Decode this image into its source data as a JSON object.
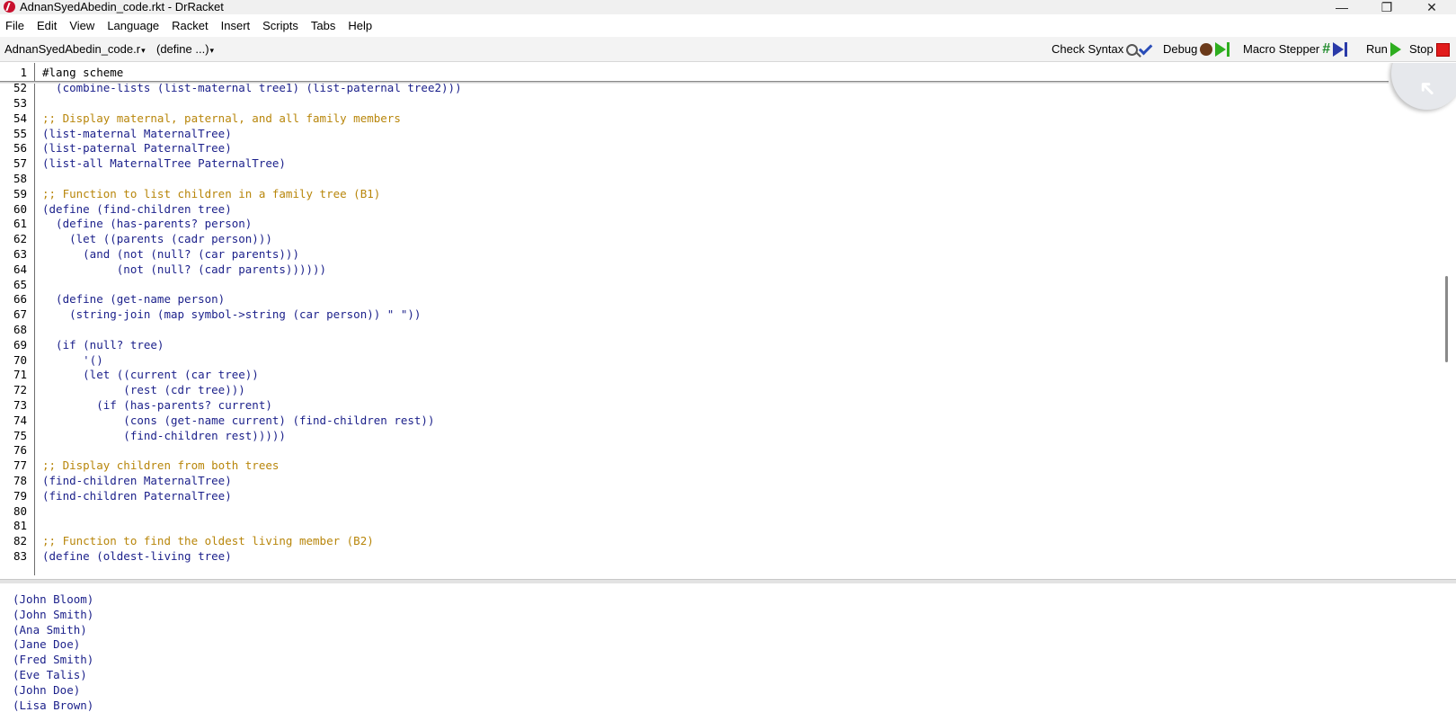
{
  "window": {
    "title": "AdnanSyedAbedin_code.rkt - DrRacket",
    "minimize_glyph": "—",
    "maximize_glyph": "❐",
    "close_glyph": "✕"
  },
  "menu": [
    "File",
    "Edit",
    "View",
    "Language",
    "Racket",
    "Insert",
    "Scripts",
    "Tabs",
    "Help"
  ],
  "toolbar": {
    "file_selector": "AdnanSyedAbedin_code.r",
    "define_selector": "(define ...)",
    "caret": "▾",
    "check_syntax": "Check Syntax",
    "debug": "Debug",
    "macro_stepper": "Macro Stepper",
    "run": "Run",
    "stop": "Stop",
    "icons": [
      "magnifier-icon",
      "checkmark-icon",
      "bug-icon",
      "play-icon",
      "hash-icon",
      "step-icon",
      "stop-icon"
    ]
  },
  "editor": {
    "lines": [
      {
        "n": "1",
        "text": "#lang scheme",
        "kind": "hash"
      },
      {
        "n": "52",
        "text": "  (combine-lists (list-maternal tree1) (list-paternal tree2)))",
        "kind": "code"
      },
      {
        "n": "53",
        "text": "",
        "kind": "code"
      },
      {
        "n": "54",
        "text": ";; Display maternal, paternal, and all family members",
        "kind": "comment"
      },
      {
        "n": "55",
        "text": "(list-maternal MaternalTree)",
        "kind": "code"
      },
      {
        "n": "56",
        "text": "(list-paternal PaternalTree)",
        "kind": "code"
      },
      {
        "n": "57",
        "text": "(list-all MaternalTree PaternalTree)",
        "kind": "code"
      },
      {
        "n": "58",
        "text": "",
        "kind": "code"
      },
      {
        "n": "59",
        "text": ";; Function to list children in a family tree (B1)",
        "kind": "comment"
      },
      {
        "n": "60",
        "text": "(define (find-children tree)",
        "kind": "code"
      },
      {
        "n": "61",
        "text": "  (define (has-parents? person)",
        "kind": "code"
      },
      {
        "n": "62",
        "text": "    (let ((parents (cadr person)))",
        "kind": "code"
      },
      {
        "n": "63",
        "text": "      (and (not (null? (car parents)))",
        "kind": "code"
      },
      {
        "n": "64",
        "text": "           (not (null? (cadr parents))))))",
        "kind": "code"
      },
      {
        "n": "65",
        "text": "",
        "kind": "code"
      },
      {
        "n": "66",
        "text": "  (define (get-name person)",
        "kind": "code"
      },
      {
        "n": "67",
        "text": "    (string-join (map symbol->string (car person)) \" \"))",
        "kind": "code"
      },
      {
        "n": "68",
        "text": "",
        "kind": "code"
      },
      {
        "n": "69",
        "text": "  (if (null? tree)",
        "kind": "code"
      },
      {
        "n": "70",
        "text": "      '()",
        "kind": "code"
      },
      {
        "n": "71",
        "text": "      (let ((current (car tree))",
        "kind": "code"
      },
      {
        "n": "72",
        "text": "            (rest (cdr tree)))",
        "kind": "code"
      },
      {
        "n": "73",
        "text": "        (if (has-parents? current)",
        "kind": "code"
      },
      {
        "n": "74",
        "text": "            (cons (get-name current) (find-children rest))",
        "kind": "code"
      },
      {
        "n": "75",
        "text": "            (find-children rest)))))",
        "kind": "code"
      },
      {
        "n": "76",
        "text": "",
        "kind": "code"
      },
      {
        "n": "77",
        "text": ";; Display children from both trees",
        "kind": "comment"
      },
      {
        "n": "78",
        "text": "(find-children MaternalTree)",
        "kind": "code"
      },
      {
        "n": "79",
        "text": "(find-children PaternalTree)",
        "kind": "code"
      },
      {
        "n": "80",
        "text": "",
        "kind": "code"
      },
      {
        "n": "81",
        "text": "",
        "kind": "code"
      },
      {
        "n": "82",
        "text": ";; Function to find the oldest living member (B2)",
        "kind": "comment"
      },
      {
        "n": "83",
        "text": "(define (oldest-living tree)",
        "kind": "code"
      }
    ]
  },
  "interactions": {
    "output": [
      "(John Bloom)",
      "(John Smith)",
      "(Ana Smith)",
      "(Jane Doe)",
      "(Fred Smith)",
      "(Eve Talis)",
      "(John Doe)",
      "(Lisa Brown)"
    ]
  },
  "colors": {
    "code": "#1a1f8a",
    "comment": "#b8860b",
    "run_green": "#2eae1f",
    "stop_red": "#e11b1b"
  }
}
